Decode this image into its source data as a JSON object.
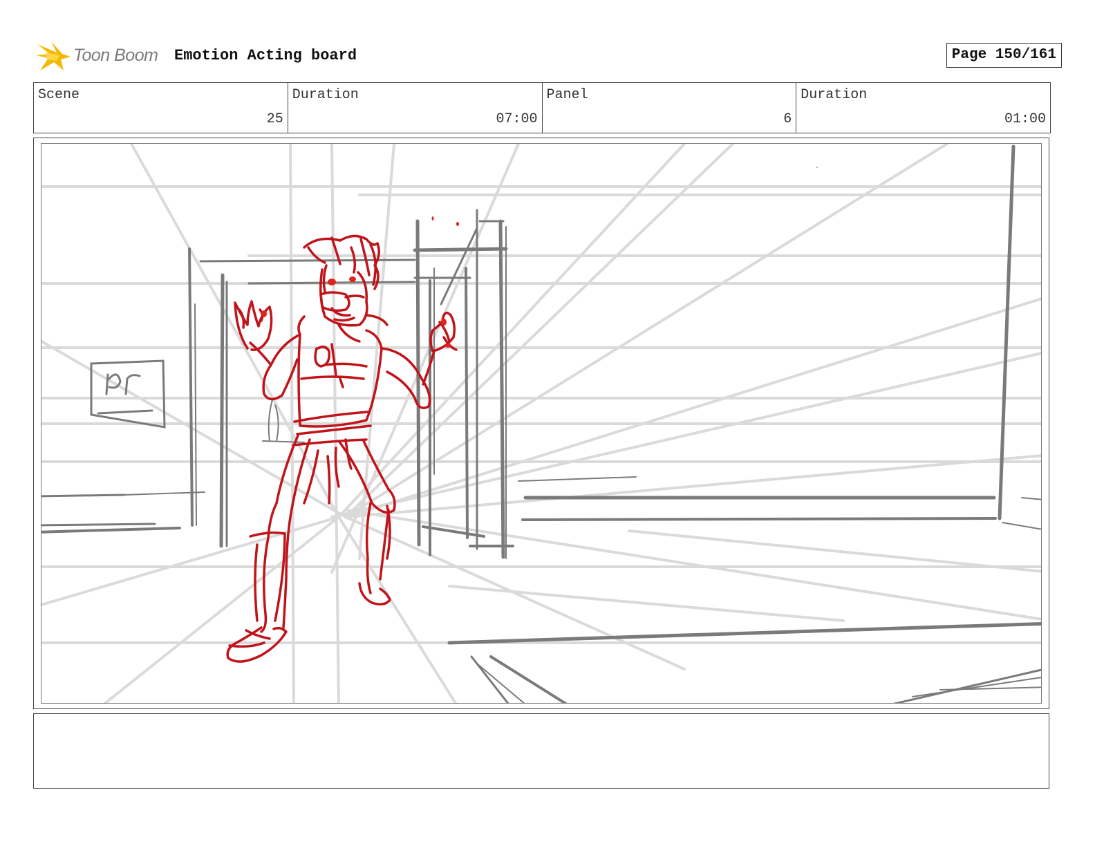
{
  "header": {
    "logo_text": "Toon Boom",
    "board_title": "Emotion Acting board",
    "page_label": "Page 150/161"
  },
  "info": {
    "scene_label": "Scene",
    "scene_value": "25",
    "scene_duration_label": "Duration",
    "scene_duration_value": "07:00",
    "panel_label": "Panel",
    "panel_value": "6",
    "panel_duration_label": "Duration",
    "panel_duration_value": "01:00"
  },
  "colors": {
    "sketch_red": "#c0141a",
    "layout_grey": "#7a7a7a",
    "guide_grey": "#d9d9d9",
    "logo_yellow": "#f5b800"
  },
  "icons": {
    "logo": "toon-boom-spark-icon"
  },
  "notes": {
    "text": ""
  }
}
